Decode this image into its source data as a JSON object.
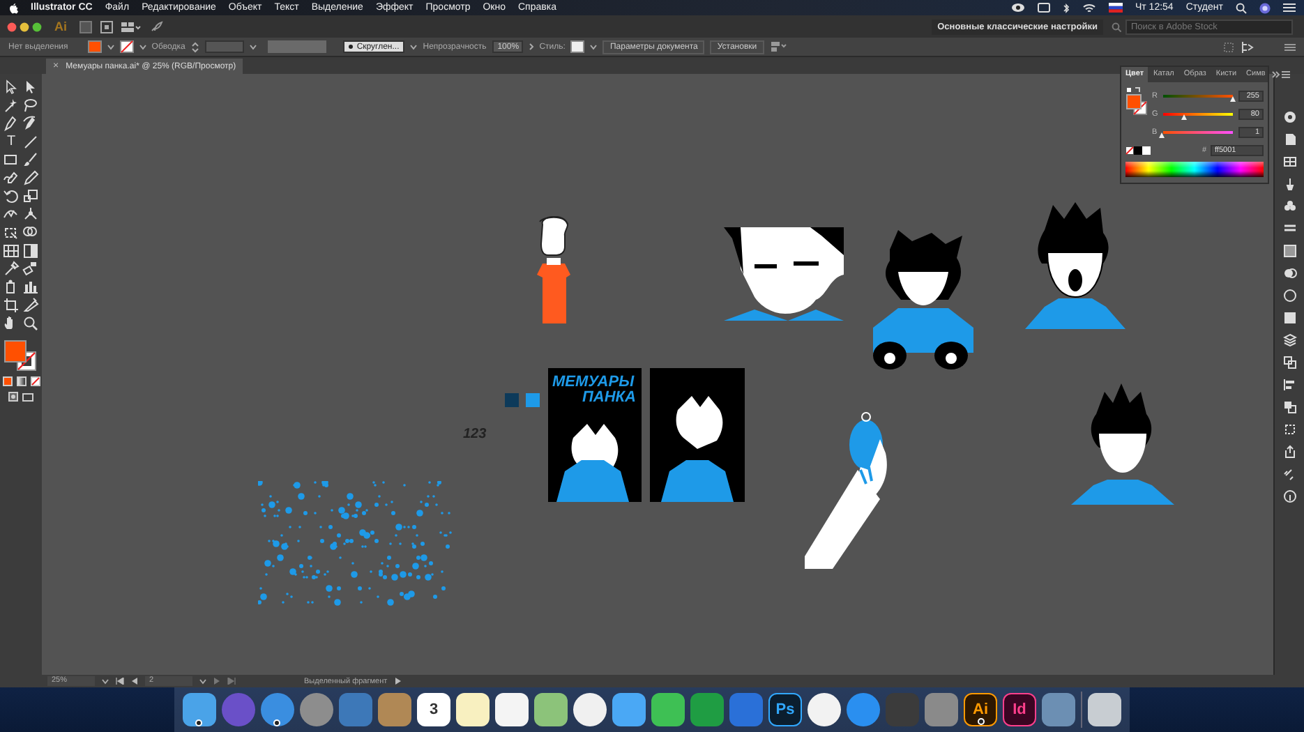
{
  "menu_bar": {
    "app_name": "Illustrator CC",
    "menus": [
      "Файл",
      "Редактирование",
      "Объект",
      "Текст",
      "Выделение",
      "Эффект",
      "Просмотр",
      "Окно",
      "Справка"
    ],
    "clock": "Чт 12:54",
    "user": "Студент"
  },
  "app_bar": {
    "logo": "Ai",
    "workspace": "Основные классические настройки",
    "search": {
      "placeholder": "Поиск в Adobe Stock"
    }
  },
  "control_bar": {
    "selection": "Нет выделения",
    "stroke_label": "Обводка",
    "brush": "Скруглен...",
    "opacity_label": "Непрозрачность",
    "opacity": "100%",
    "style_label": "Стиль:",
    "buttons": [
      "Параметры документа",
      "Установки"
    ]
  },
  "document_tab": {
    "close": "×",
    "title": "Мемуары панка.ai* @ 25% (RGB/Просмотр)"
  },
  "toolbar": {
    "type_tool": "T"
  },
  "canvas": {
    "swatches": [
      {
        "color": "#0d3a5a"
      },
      {
        "color": "#1e9ae8"
      }
    ],
    "number_text": "123",
    "poster_title": [
      "МЕМУАРЫ",
      "ПАНКА"
    ]
  },
  "color_panel": {
    "tabs": [
      {
        "label": "Цвет",
        "selected": true
      },
      {
        "label": "Катал",
        "selected": false
      },
      {
        "label": "Образ",
        "selected": false
      },
      {
        "label": "Кисти",
        "selected": false
      },
      {
        "label": "Симв",
        "selected": false
      }
    ],
    "channels": [
      {
        "name": "R",
        "level": 1,
        "reading": "255"
      },
      {
        "name": "G",
        "level": 0.31,
        "reading": "80"
      },
      {
        "name": "B",
        "level": 0.004,
        "reading": "1"
      }
    ],
    "hex_label": "#",
    "hex": "ff5001"
  },
  "status_bar": {
    "zoom": "25%",
    "artboard": "2",
    "info": "Выделенный фрагмент"
  },
  "dock": {
    "items": [
      {
        "kind": "finder",
        "running": true
      },
      {
        "kind": "siri",
        "running": false
      },
      {
        "kind": "safari",
        "running": true
      },
      {
        "kind": "launchpad",
        "running": false
      },
      {
        "kind": "preview",
        "running": false
      },
      {
        "kind": "contacts",
        "running": false
      },
      {
        "kind": "calendar",
        "label": "3",
        "running": false
      },
      {
        "kind": "notes",
        "running": false
      },
      {
        "kind": "reminders",
        "running": false
      },
      {
        "kind": "maps",
        "running": false
      },
      {
        "kind": "photos",
        "running": false
      },
      {
        "kind": "messages",
        "running": false
      },
      {
        "kind": "facetime",
        "running": false
      },
      {
        "kind": "numbers",
        "running": false
      },
      {
        "kind": "keynote",
        "running": false
      },
      {
        "kind": "photoshop",
        "label": "Ps",
        "running": false
      },
      {
        "kind": "music",
        "running": false
      },
      {
        "kind": "appstore",
        "running": false
      },
      {
        "kind": "sublime",
        "running": false
      },
      {
        "kind": "settings",
        "running": false
      },
      {
        "kind": "illustrator",
        "label": "Ai",
        "running": true
      },
      {
        "kind": "indesign",
        "label": "Id",
        "running": false
      },
      {
        "kind": "photo",
        "running": false
      },
      {
        "kind": "trash",
        "running": false
      }
    ]
  }
}
